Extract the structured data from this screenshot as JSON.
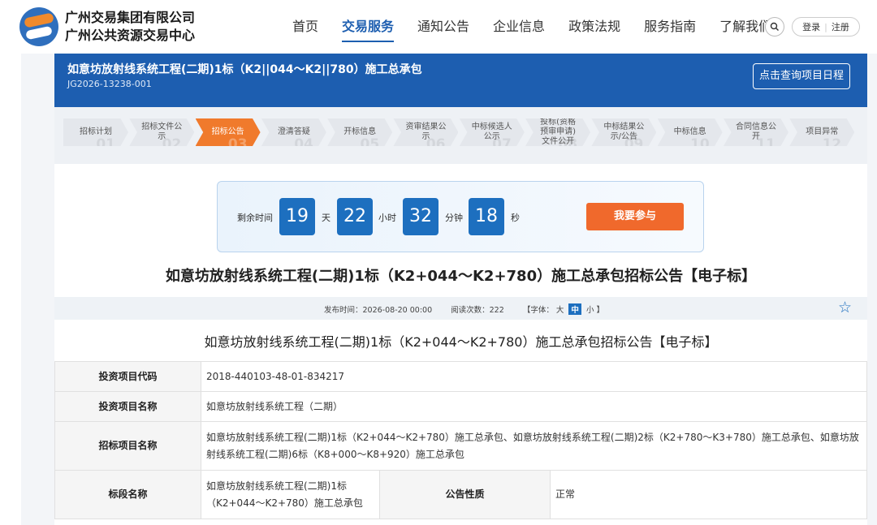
{
  "header": {
    "org_name_1": "广州交易集团有限公司",
    "org_name_2": "广州公共资源交易中心",
    "nav": [
      "首页",
      "交易服务",
      "通知公告",
      "企业信息",
      "政策法规",
      "服务指南",
      "了解我们"
    ],
    "active_nav": 1,
    "login": "登录",
    "register": "注册",
    "search_icon": "search-icon"
  },
  "project": {
    "title": "如意坊放射线系统工程(二期)1标（K2||044～K2||780）施工总承包",
    "code": "JG2026-13238-001",
    "schedule_button": "点击查询项目日程"
  },
  "steps": [
    {
      "label": "招标计划",
      "num": "01"
    },
    {
      "label": "招标文件公示",
      "num": "02"
    },
    {
      "label": "招标公告",
      "num": "03",
      "active": true
    },
    {
      "label": "澄清答疑",
      "num": "04"
    },
    {
      "label": "开标信息",
      "num": "05"
    },
    {
      "label": "资审结果公示",
      "num": "06"
    },
    {
      "label": "中标候选人公示",
      "num": "07"
    },
    {
      "label": "投标(资格预审申请)文件公开",
      "num": "08"
    },
    {
      "label": "中标结果公示/公告",
      "num": "09"
    },
    {
      "label": "中标信息",
      "num": "10"
    },
    {
      "label": "合同信息公开",
      "num": "11"
    },
    {
      "label": "项目异常",
      "num": "12"
    }
  ],
  "countdown": {
    "label": "剩余时间",
    "days": "19",
    "days_unit": "天",
    "hours": "22",
    "hours_unit": "小时",
    "minutes": "32",
    "minutes_unit": "分钟",
    "seconds": "18",
    "seconds_unit": "秒",
    "join_button": "我要参与"
  },
  "article": {
    "title": "如意坊放射线系统工程(二期)1标（K2+044～K2+780）施工总承包招标公告【电子标】",
    "publish_time": "发布时间：2026-08-20 00:00",
    "read_count": "阅读次数：222",
    "font_label": "【字体：",
    "font_large": "大",
    "font_medium": "中",
    "font_small": "小 】",
    "subtitle": "如意坊放射线系统工程(二期)1标（K2+044～K2+780）施工总承包招标公告【电子标】"
  },
  "table": {
    "rows": [
      {
        "key": "投资项目代码",
        "value": "2018-440103-48-01-834217"
      },
      {
        "key": "投资项目名称",
        "value": "如意坊放射线系统工程（二期）"
      },
      {
        "key": "招标项目名称",
        "value": "如意坊放射线系统工程(二期)1标（K2+044～K2+780）施工总承包、如意坊放射线系统工程(二期)2标（K2+780～K3+780）施工总承包、如意坊放射线系统工程(二期)6标（K8+000～K8+920）施工总承包"
      }
    ],
    "segment_key": "标段名称",
    "segment_value": "如意坊放射线系统工程(二期)1标（K2+044～K2+780）施工总承包",
    "nature_key": "公告性质",
    "nature_value": "正常"
  }
}
